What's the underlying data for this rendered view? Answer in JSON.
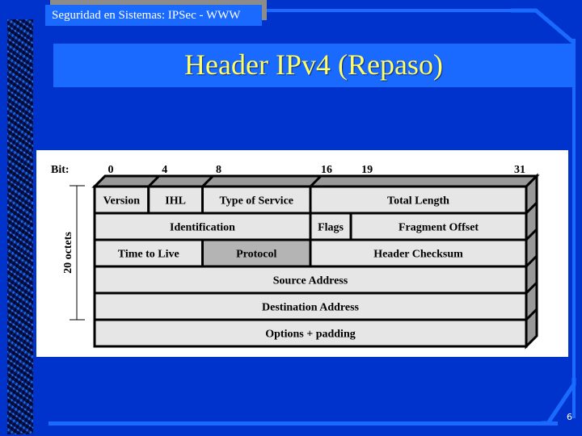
{
  "slide": {
    "course_title": "Seguridad en Sistemas: IPSec - WWW",
    "title": "Header IPv4 (Repaso)",
    "page_number": "6"
  },
  "colors": {
    "background": "#0033cc",
    "accent": "#1a6aff",
    "title_text": "#ffff66",
    "cell_fill": "#e6e6e6",
    "cell_highlight": "#b4b4b4",
    "cell_3d": "#999999"
  },
  "diagram": {
    "bit_label": "Bit:",
    "bit_ticks": [
      {
        "label": "0",
        "bit": 0
      },
      {
        "label": "4",
        "bit": 4
      },
      {
        "label": "8",
        "bit": 8
      },
      {
        "label": "16",
        "bit": 16
      },
      {
        "label": "19",
        "bit": 19
      },
      {
        "label": "31",
        "bit": 31
      }
    ],
    "size_label": "20 octets",
    "rows": [
      [
        {
          "label": "Version",
          "start": 0,
          "end": 4
        },
        {
          "label": "IHL",
          "start": 4,
          "end": 8
        },
        {
          "label": "Type of Service",
          "start": 8,
          "end": 16
        },
        {
          "label": "Total Length",
          "start": 16,
          "end": 32
        }
      ],
      [
        {
          "label": "Identification",
          "start": 0,
          "end": 16
        },
        {
          "label": "Flags",
          "start": 16,
          "end": 19
        },
        {
          "label": "Fragment Offset",
          "start": 19,
          "end": 32
        }
      ],
      [
        {
          "label": "Time to Live",
          "start": 0,
          "end": 8
        },
        {
          "label": "Protocol",
          "start": 8,
          "end": 16,
          "highlighted": true
        },
        {
          "label": "Header Checksum",
          "start": 16,
          "end": 32
        }
      ],
      [
        {
          "label": "Source Address",
          "start": 0,
          "end": 32
        }
      ],
      [
        {
          "label": "Destination Address",
          "start": 0,
          "end": 32
        }
      ],
      [
        {
          "label": "Options + padding",
          "start": 0,
          "end": 32
        }
      ]
    ]
  }
}
